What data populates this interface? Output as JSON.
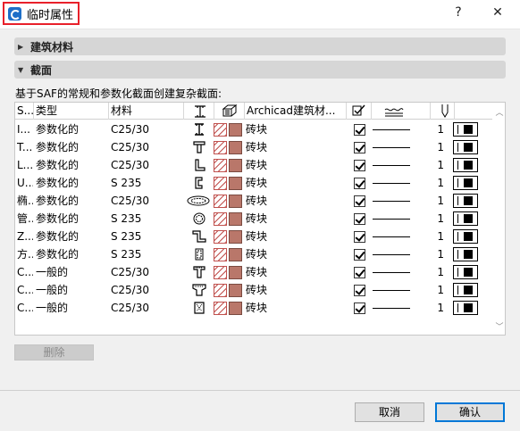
{
  "window": {
    "title": "临时属性",
    "help_glyph": "?",
    "close_glyph": "✕",
    "app_icon": "archicad-app-icon"
  },
  "sections": {
    "building_materials": "建筑材料",
    "cross_sections": "截面"
  },
  "description": "基于SAF的常规和参数化截面创建复杂截面:",
  "table": {
    "headers": {
      "saf": "S...",
      "type": "类型",
      "material": "材料",
      "profile_icon": "profile-shape-icon",
      "surface_icon": "surface-material-icon",
      "archicad_material": "Archicad建筑材...",
      "override_icon": "override-checkbox-icon",
      "linetype_icon": "line-type-icon",
      "pen_icon": "pen-number-icon"
    },
    "rows": [
      {
        "saf": "I...",
        "type": "参数化的",
        "material": "C25/30",
        "archicad": "砖块",
        "pen": "1",
        "profile": "I-shape"
      },
      {
        "saf": "T...",
        "type": "参数化的",
        "material": "C25/30",
        "archicad": "砖块",
        "pen": "1",
        "profile": "T-shape"
      },
      {
        "saf": "L...",
        "type": "参数化的",
        "material": "C25/30",
        "archicad": "砖块",
        "pen": "1",
        "profile": "L-shape"
      },
      {
        "saf": "U...",
        "type": "参数化的",
        "material": "S 235",
        "archicad": "砖块",
        "pen": "1",
        "profile": "U-shape"
      },
      {
        "saf": "椭...",
        "type": "参数化的",
        "material": "C25/30",
        "archicad": "砖块",
        "pen": "1",
        "profile": "ellipse-shape"
      },
      {
        "saf": "管...",
        "type": "参数化的",
        "material": "S 235",
        "archicad": "砖块",
        "pen": "1",
        "profile": "tube-shape"
      },
      {
        "saf": "Z...",
        "type": "参数化的",
        "material": "S 235",
        "archicad": "砖块",
        "pen": "1",
        "profile": "Z-shape"
      },
      {
        "saf": "方...",
        "type": "参数化的",
        "material": "S 235",
        "archicad": "砖块",
        "pen": "1",
        "profile": "rect-tube-shape"
      },
      {
        "saf": "C...",
        "type": "一般的",
        "material": "C25/30",
        "archicad": "砖块",
        "pen": "1",
        "profile": "general-T-shape"
      },
      {
        "saf": "C...",
        "type": "一般的",
        "material": "C25/30",
        "archicad": "砖块",
        "pen": "1",
        "profile": "general-trapezoid-shape"
      },
      {
        "saf": "C...",
        "type": "一般的",
        "material": "C25/30",
        "archicad": "砖块",
        "pen": "1",
        "profile": "general-box-shape"
      }
    ]
  },
  "buttons": {
    "delete": "删除",
    "cancel": "取消",
    "ok": "确认"
  },
  "colors": {
    "highlight_border": "#e8202a",
    "hatch": "#c0504d",
    "fill": "#b9776a",
    "primary_border": "#0078d7"
  }
}
